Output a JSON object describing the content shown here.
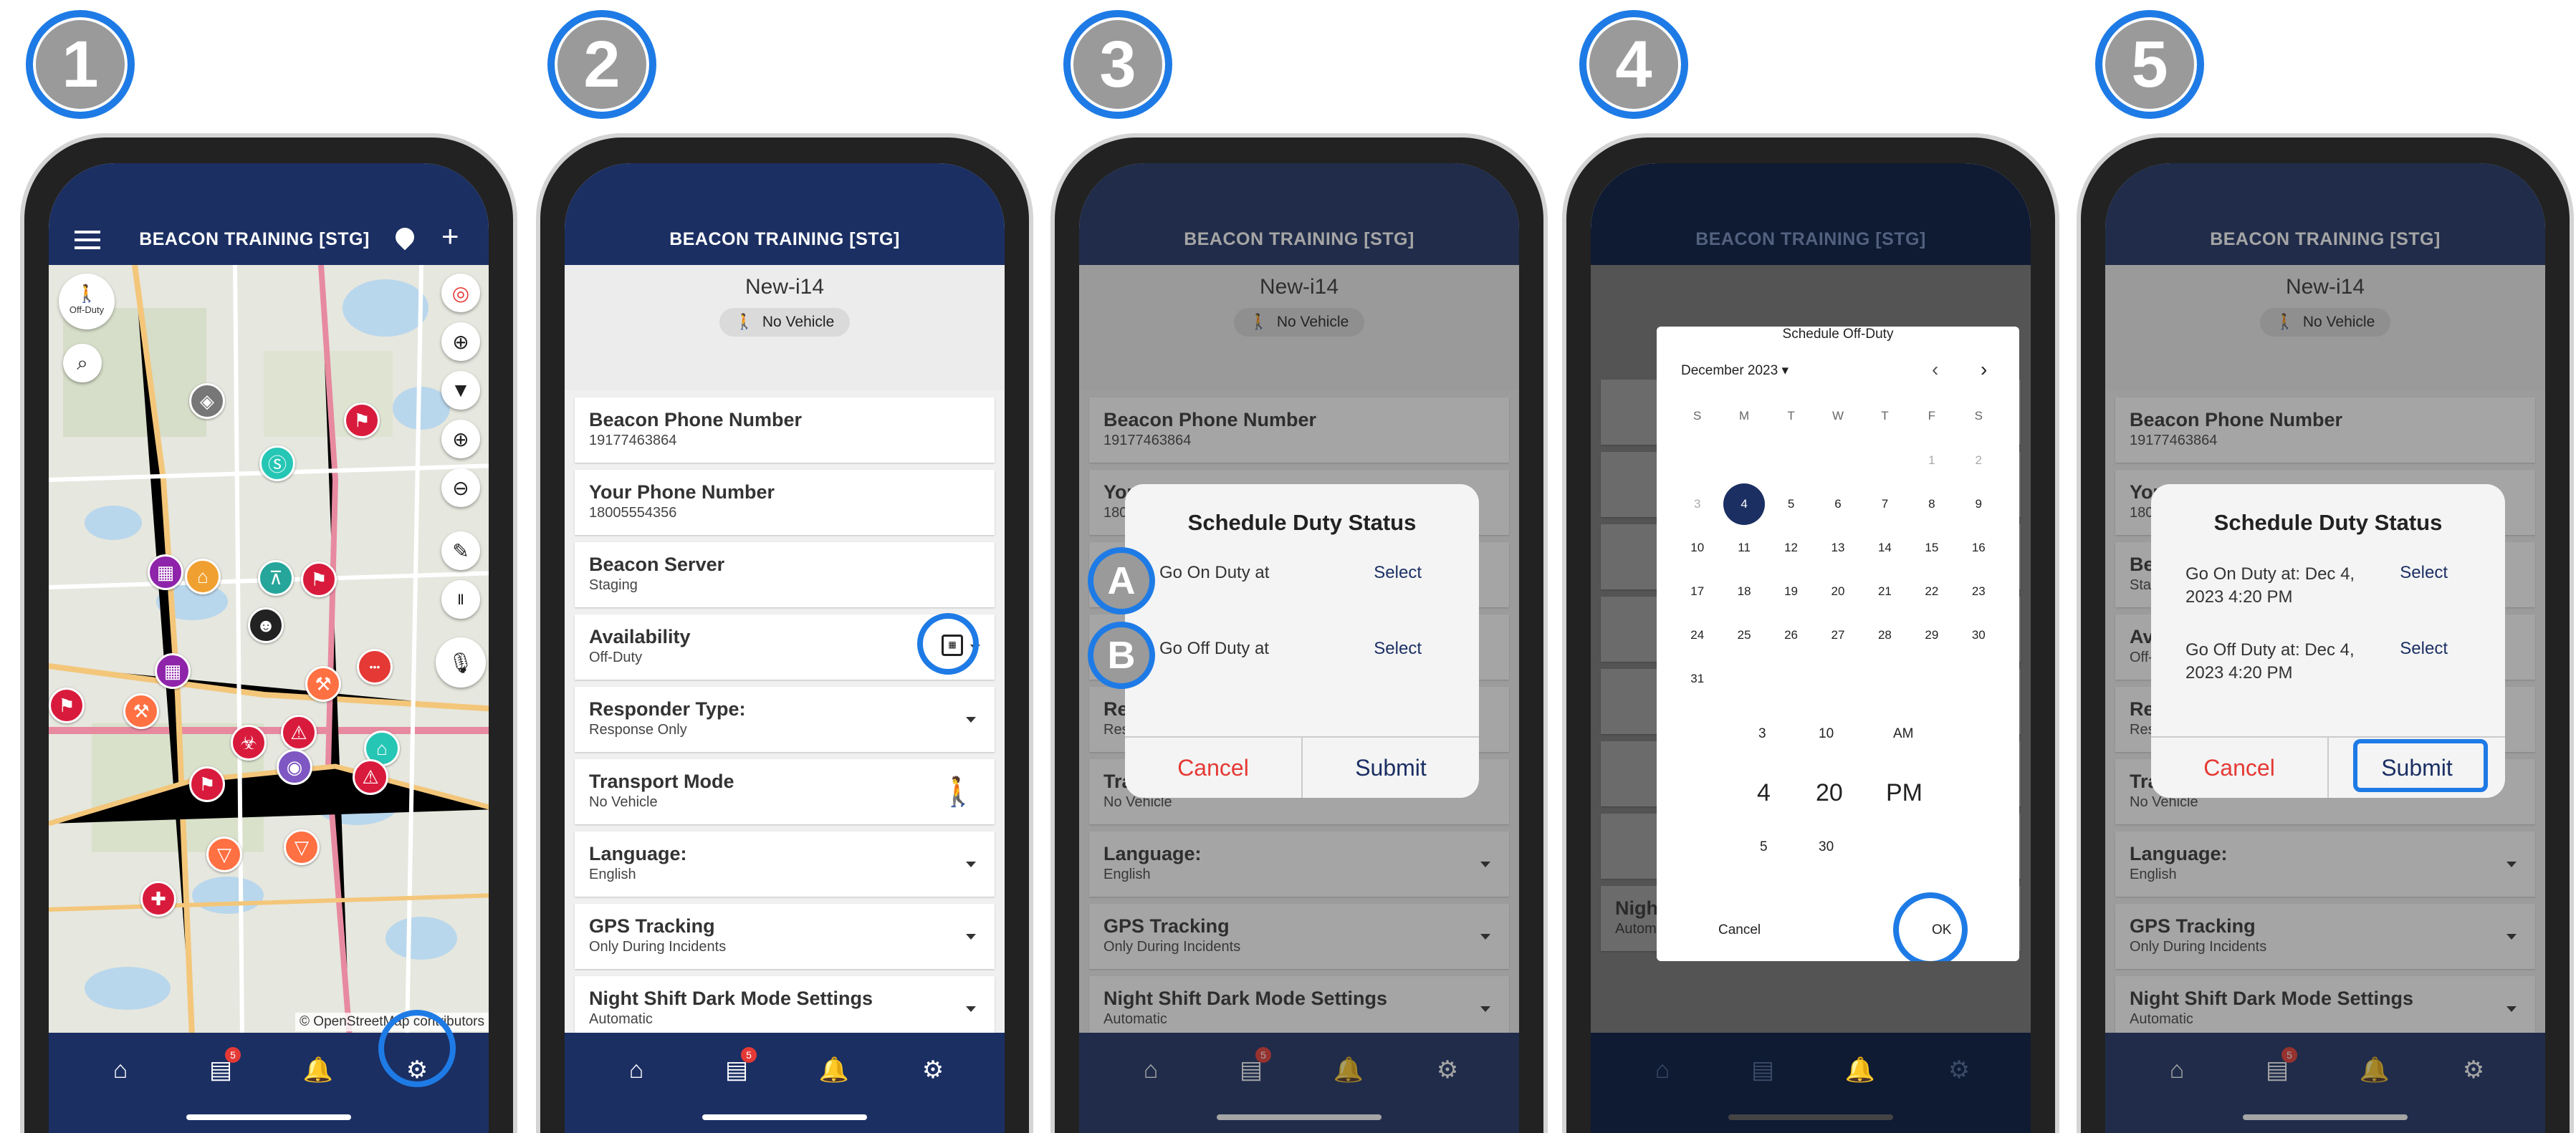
{
  "steps": [
    "1",
    "2",
    "3",
    "4",
    "5"
  ],
  "app": {
    "title": "BEACON TRAINING [STG]"
  },
  "map": {
    "off_duty_label": "Off-Duty",
    "attribution": "© OpenStreetMap contributors"
  },
  "tabs": {
    "chat_badge": "5"
  },
  "profile": {
    "name": "New-i14",
    "vehicle": "No Vehicle"
  },
  "settings": [
    {
      "title": "Beacon Phone Number",
      "value": "19177463864"
    },
    {
      "title": "Your Phone Number",
      "value": "18005554356"
    },
    {
      "title": "Beacon Server",
      "value": "Staging"
    },
    {
      "title": "Availability",
      "value": "Off-Duty"
    },
    {
      "title": "Responder Type:",
      "value": "Response Only"
    },
    {
      "title": "Transport Mode",
      "value": "No Vehicle"
    },
    {
      "title": "Language:",
      "value": "English"
    },
    {
      "title": "GPS Tracking",
      "value": "Only During Incidents"
    },
    {
      "title": "Night Shift Dark Mode Settings",
      "value": "Automatic"
    }
  ],
  "dialog": {
    "title": "Schedule Duty Status",
    "on_label": "Go On Duty at",
    "off_label": "Go Off Duty at",
    "select": "Select",
    "cancel": "Cancel",
    "submit": "Submit",
    "on_filled": "Go On Duty at: Dec 4, 2023 4:20 PM",
    "off_filled": "Go Off Duty at: Dec 4, 2023 4:20 PM",
    "marker_a": "A",
    "marker_b": "B"
  },
  "calendar": {
    "title": "Schedule Off-Duty",
    "month": "December 2023",
    "weekdays": [
      "S",
      "M",
      "T",
      "W",
      "T",
      "F",
      "S"
    ],
    "selected_day": "4",
    "days": [
      "",
      "",
      "",
      "",
      "",
      "1",
      "2",
      "3",
      "4",
      "5",
      "6",
      "7",
      "8",
      "9",
      "10",
      "11",
      "12",
      "13",
      "14",
      "15",
      "16",
      "17",
      "18",
      "19",
      "20",
      "21",
      "22",
      "23",
      "24",
      "25",
      "26",
      "27",
      "28",
      "29",
      "30",
      "31"
    ],
    "time_prev": [
      "3",
      "10",
      "AM"
    ],
    "time_sel": [
      "4",
      "20",
      "PM"
    ],
    "time_next": [
      "5",
      "30"
    ],
    "cancel": "Cancel",
    "ok": "OK"
  },
  "colors": {
    "navy": "#1b2f63",
    "highlight": "#1e7be6",
    "cancel_red": "#e53935"
  }
}
